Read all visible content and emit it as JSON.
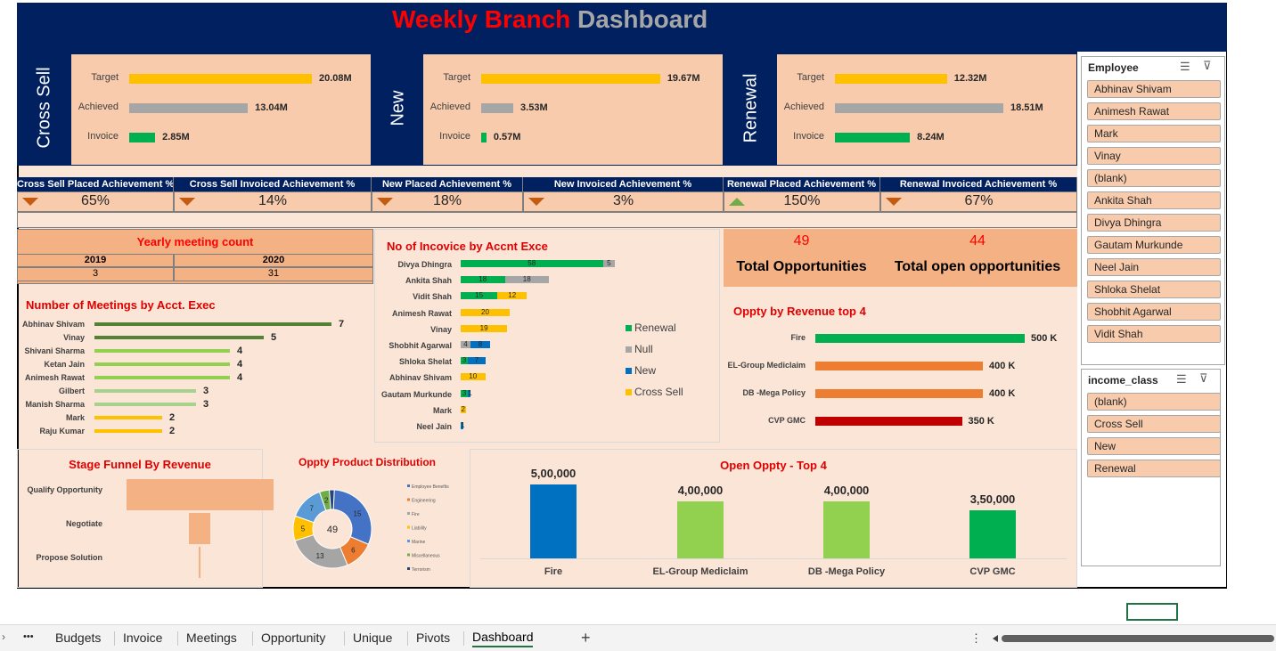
{
  "title": {
    "part1": "Weekly Branch",
    "part2": "Dashboard"
  },
  "colors": {
    "navy": "#002060",
    "gold": "#ffc000",
    "gray": "#a6a6a6",
    "green": "#00b050",
    "orange": "#ed7d31",
    "red": "#ff0000"
  },
  "panels": {
    "cross_sell": {
      "name": "Cross Sell",
      "target_label": "Target",
      "target": "20.08M",
      "achieved_label": "Achieved",
      "achieved": "13.04M",
      "invoice_label": "Invoice",
      "invoice": "2.85M",
      "target_v": 20.08,
      "achieved_v": 13.04,
      "invoice_v": 2.85
    },
    "new": {
      "name": "New",
      "target_label": "Target",
      "target": "19.67M",
      "achieved_label": "Achieved",
      "achieved": "3.53M",
      "invoice_label": "Invoice",
      "invoice": "0.57M",
      "target_v": 19.67,
      "achieved_v": 3.53,
      "invoice_v": 0.57
    },
    "renewal": {
      "name": "Renewal",
      "target_label": "Target",
      "target": "12.32M",
      "achieved_label": "Achieved",
      "achieved": "18.51M",
      "invoice_label": "Invoice",
      "invoice": "8.24M",
      "target_v": 12.32,
      "achieved_v": 18.51,
      "invoice_v": 8.24
    }
  },
  "kpis": [
    {
      "label": "Cross Sell Placed Achievement %",
      "value": "65%",
      "trend": "down"
    },
    {
      "label": "Cross Sell Invoiced Achievement %",
      "value": "14%",
      "trend": "down"
    },
    {
      "label": "New Placed Achievement %",
      "value": "18%",
      "trend": "down"
    },
    {
      "label": "New Invoiced Achievement %",
      "value": "3%",
      "trend": "down"
    },
    {
      "label": "Renewal Placed Achievement %",
      "value": "150%",
      "trend": "up"
    },
    {
      "label": "Renewal Invoiced Achievement %",
      "value": "67%",
      "trend": "down"
    }
  ],
  "yearly": {
    "title": "Yearly meeting count",
    "col1": "2019",
    "col2": "2020",
    "v1": "3",
    "v2": "31"
  },
  "opportunities": {
    "total": "49",
    "total_label": "Total Opportunities",
    "open": "44",
    "open_label": "Total open opportunities"
  },
  "meetings": {
    "title": "Number of Meetings by Acct. Exec",
    "rows": [
      {
        "name": "Abhinav Shivam",
        "value": "7",
        "v": 7
      },
      {
        "name": "Vinay",
        "value": "5",
        "v": 5
      },
      {
        "name": "Shivani Sharma",
        "value": "4",
        "v": 4
      },
      {
        "name": "Ketan Jain",
        "value": "4",
        "v": 4
      },
      {
        "name": "Animesh Rawat",
        "value": "4",
        "v": 4
      },
      {
        "name": "Gilbert",
        "value": "3",
        "v": 3
      },
      {
        "name": "Manish Sharma",
        "value": "3",
        "v": 3
      },
      {
        "name": "Mark",
        "value": "2",
        "v": 2
      },
      {
        "name": "Raju Kumar",
        "value": "2",
        "v": 2
      }
    ]
  },
  "invoices": {
    "title": "No of Incovice by Accnt Exce",
    "legend": [
      "Renewal",
      "Null",
      "New",
      "Cross Sell"
    ],
    "rows": [
      {
        "name": "Divya Dhingra",
        "segs": [
          {
            "k": "renewal",
            "v": 58,
            "t": "58"
          },
          {
            "k": "null",
            "v": 5,
            "t": "5"
          }
        ]
      },
      {
        "name": "Ankita Shah",
        "segs": [
          {
            "k": "renewal",
            "v": 18,
            "t": "18"
          },
          {
            "k": "null",
            "v": 18,
            "t": "18"
          }
        ]
      },
      {
        "name": "Vidit Shah",
        "segs": [
          {
            "k": "renewal",
            "v": 15,
            "t": "15"
          },
          {
            "k": "cross",
            "v": 12,
            "t": "12"
          }
        ]
      },
      {
        "name": "Animesh Rawat",
        "segs": [
          {
            "k": "cross",
            "v": 20,
            "t": "20"
          }
        ]
      },
      {
        "name": "Vinay",
        "segs": [
          {
            "k": "cross",
            "v": 19,
            "t": "19"
          }
        ]
      },
      {
        "name": "Shobhit Agarwal",
        "segs": [
          {
            "k": "null",
            "v": 4,
            "t": "4"
          },
          {
            "k": "new",
            "v": 8,
            "t": "8"
          }
        ]
      },
      {
        "name": "Shloka Shelat",
        "segs": [
          {
            "k": "renewal",
            "v": 3,
            "t": "3"
          },
          {
            "k": "new",
            "v": 7,
            "t": "7"
          }
        ]
      },
      {
        "name": "Abhinav Shivam",
        "segs": [
          {
            "k": "cross",
            "v": 10,
            "t": "10"
          }
        ]
      },
      {
        "name": "Gautam Murkunde",
        "segs": [
          {
            "k": "renewal",
            "v": 3,
            "t": "3"
          },
          {
            "k": "new",
            "v": 1,
            "t": "1"
          }
        ]
      },
      {
        "name": "Mark",
        "segs": [
          {
            "k": "cross",
            "v": 2,
            "t": "2"
          }
        ]
      },
      {
        "name": "Neel Jain",
        "segs": [
          {
            "k": "new",
            "v": 1,
            "t": "1"
          }
        ]
      }
    ]
  },
  "oppty_revenue": {
    "title": "Oppty by Revenue top 4",
    "rows": [
      {
        "name": "Fire",
        "value": "500 K",
        "v": 500,
        "color": "#00b050"
      },
      {
        "name": "EL-Group Mediclaim",
        "value": "400 K",
        "v": 400,
        "color": "#ed7d31"
      },
      {
        "name": "DB -Mega Policy",
        "value": "400 K",
        "v": 400,
        "color": "#ed7d31"
      },
      {
        "name": "CVP GMC",
        "value": "350 K",
        "v": 350,
        "color": "#c00000"
      }
    ]
  },
  "funnel": {
    "title": "Stage Funnel By Revenue",
    "stages": [
      {
        "name": "Qualify Opportunity",
        "v": 100
      },
      {
        "name": "Negotiate",
        "v": 14
      },
      {
        "name": "Propose Solution",
        "v": 1
      }
    ]
  },
  "donut": {
    "title": "Oppty Product Distribution",
    "center": "49",
    "slices": [
      {
        "name": "Employee Benefits",
        "v": 15,
        "label": "15",
        "color": "#4472c4"
      },
      {
        "name": "Engineering",
        "v": 6,
        "label": "6",
        "color": "#ed7d31"
      },
      {
        "name": "Fire",
        "v": 13,
        "label": "13",
        "color": "#a5a5a5"
      },
      {
        "name": "Liability",
        "v": 5,
        "label": "5",
        "color": "#ffc000"
      },
      {
        "name": "Marine",
        "v": 7,
        "label": "7",
        "color": "#5b9bd5"
      },
      {
        "name": "Miscellaneous",
        "v": 2,
        "label": "2",
        "color": "#70ad47"
      },
      {
        "name": "Terrorism",
        "v": 1,
        "label": "",
        "color": "#264478"
      }
    ]
  },
  "open_top4": {
    "title": "Open Oppty - Top 4",
    "ymax": 600000,
    "bars": [
      {
        "name": "Fire",
        "value": "5,00,000",
        "v": 500000,
        "color": "#0070c0"
      },
      {
        "name": "EL-Group Mediclaim",
        "value": "4,00,000",
        "v": 400000,
        "color": "#92d050"
      },
      {
        "name": "DB -Mega Policy",
        "value": "4,00,000",
        "v": 400000,
        "color": "#92d050"
      },
      {
        "name": "CVP GMC",
        "value": "3,50,000",
        "v": 350000,
        "color": "#00b050"
      }
    ]
  },
  "slicer_employee": {
    "title": "Employee",
    "items": [
      "Abhinav Shivam",
      "Animesh Rawat",
      "Mark",
      "Vinay",
      "(blank)",
      "Ankita Shah",
      "Divya Dhingra",
      "Gautam Murkunde",
      "Neel Jain",
      "Shloka Shelat",
      "Shobhit Agarwal",
      "Vidit Shah"
    ]
  },
  "slicer_income": {
    "title": "income_class",
    "items": [
      "(blank)",
      "Cross Sell",
      "New",
      "Renewal"
    ]
  },
  "sheet_tabs": [
    "Budgets",
    "Invoice",
    "Meetings",
    "Opportunity",
    "Unique",
    "Pivots",
    "Dashboard"
  ],
  "active_tab": "Dashboard",
  "tab_more": "•••",
  "tab_add": "+",
  "tab_options": "⋮"
}
